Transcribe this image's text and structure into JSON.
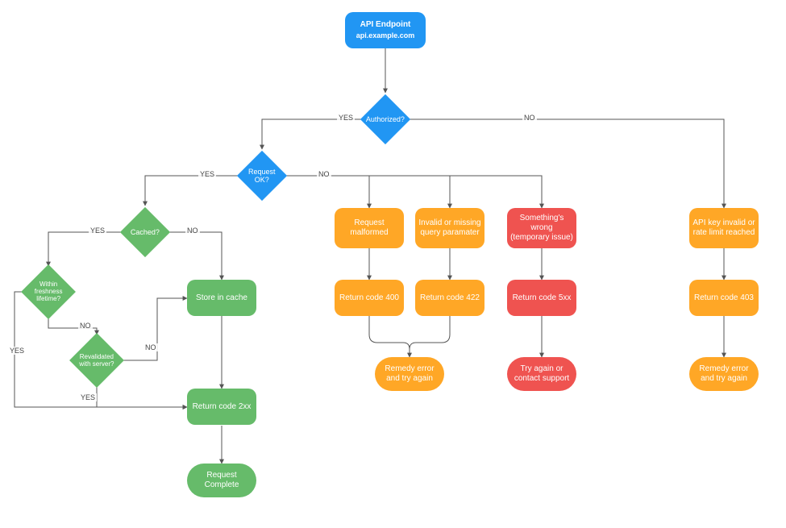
{
  "start": {
    "title": "API Endpoint",
    "subtitle": "api.example.com"
  },
  "decisions": {
    "authorized": "Authorized?",
    "requestOk": "Request OK?",
    "cached": "Cached?",
    "freshness": "Within freshness lifetime?",
    "revalidated": "Revalidated with server?"
  },
  "boxes": {
    "storeCache": "Store in cache",
    "return2xx": "Return code 2xx",
    "requestComplete": "Request Complete",
    "reqMalformed": "Request malformed",
    "return400": "Return code 400",
    "invalidQuery": "Invalid or missing query paramater",
    "return422": "Return code 422",
    "remedyErrorTry": "Remedy error and try again",
    "somethingWrong": "Something's wrong (temporary issue)",
    "return5xx": "Return code 5xx",
    "tryAgainSupport": "Try again or contact support",
    "apiKeyInvalid": "API key invalid or rate limit reached",
    "return403": "Return code 403",
    "remedyErrorTry2": "Remedy error and try again"
  },
  "labels": {
    "yes": "YES",
    "no": "NO"
  }
}
